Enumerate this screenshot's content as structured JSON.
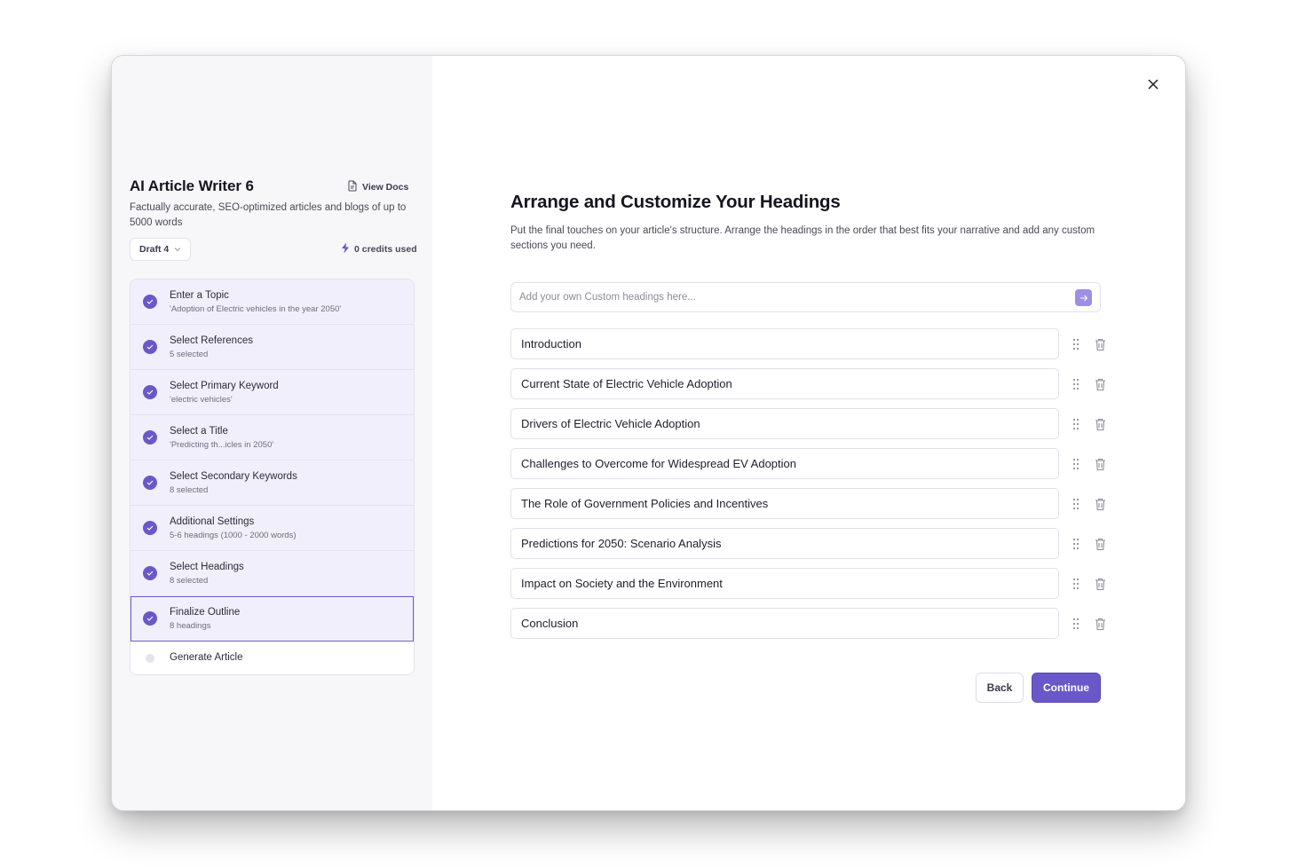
{
  "sidebar": {
    "title": "AI Article Writer 6",
    "view_docs": "View Docs",
    "description": "Factually accurate, SEO-optimized articles and blogs of up to 5000 words",
    "draft": "Draft 4",
    "credits": "0 credits used",
    "steps": [
      {
        "title": "Enter a Topic",
        "sub": "'Adoption of Electric vehicles in the year 2050'",
        "status": "done"
      },
      {
        "title": "Select References",
        "sub": "5 selected",
        "status": "done"
      },
      {
        "title": "Select Primary Keyword",
        "sub": "'electric vehicles'",
        "status": "done"
      },
      {
        "title": "Select a Title",
        "sub": "'Predicting th...icles in 2050'",
        "status": "done"
      },
      {
        "title": "Select Secondary Keywords",
        "sub": "8 selected",
        "status": "done"
      },
      {
        "title": "Additional Settings",
        "sub": "5-6 headings (1000 - 2000 words)",
        "status": "done"
      },
      {
        "title": "Select Headings",
        "sub": "8 selected",
        "status": "done"
      },
      {
        "title": "Finalize Outline",
        "sub": "8 headings",
        "status": "active"
      },
      {
        "title": "Generate Article",
        "sub": "",
        "status": "pending"
      }
    ]
  },
  "main": {
    "title": "Arrange and Customize Your Headings",
    "description": "Put the final touches on your article's structure. Arrange the headings in the order that best fits your narrative and add any custom sections you need.",
    "custom_input": {
      "placeholder": "Add your own Custom headings here...",
      "value": ""
    },
    "headings": [
      "Introduction",
      "Current State of Electric Vehicle Adoption",
      "Drivers of Electric Vehicle Adoption",
      "Challenges to Overcome for Widespread EV Adoption",
      "The Role of Government Policies and Incentives",
      "Predictions for 2050: Scenario Analysis",
      "Impact on Society and the Environment",
      "Conclusion"
    ],
    "back_label": "Back",
    "continue_label": "Continue"
  },
  "colors": {
    "accent": "#6a57c8",
    "accent_light": "#9f8fe3",
    "step_bg": "#f1effc",
    "sidebar_bg": "#f7f7f9"
  },
  "icons": {
    "close": "close-icon",
    "docs": "document-icon",
    "credits": "lightning-icon",
    "chevron": "chevron-down-icon",
    "check": "check-icon",
    "drag": "drag-handle-icon",
    "delete": "trash-icon",
    "arrow": "arrow-right-icon"
  }
}
